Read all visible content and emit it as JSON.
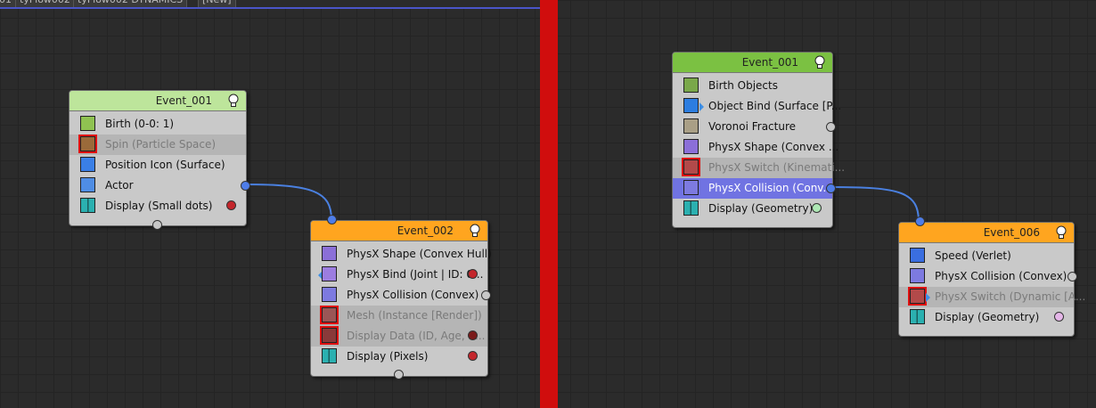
{
  "tabs": [
    "01",
    "tyFlow002",
    "tyFlow002 DYNAMICS",
    "[New]"
  ],
  "colors": {
    "header_green_light": "#bde59b",
    "header_green": "#7bc142",
    "header_orange": "#ffa51f",
    "wire": "#4a80e0",
    "port_blue": "#4e7de8",
    "port_gray": "#c8c8c8",
    "swatch_red": "#c4262c",
    "swatch_darkred": "#7a1a1a",
    "swatch_green": "#aee8b5",
    "swatch_pink": "#e5b6e8",
    "divider_red": "#d00d0d"
  },
  "nodes": [
    {
      "title": "Event_001",
      "operators": [
        {
          "label": "Birth (0-0: 1)",
          "icon": "birth-icon"
        },
        {
          "label": "Spin (Particle Space)",
          "icon": "spin-icon",
          "disabled": true
        },
        {
          "label": "Position Icon (Surface)",
          "icon": "position-icon"
        },
        {
          "label": "Actor",
          "icon": "actor-icon"
        },
        {
          "label": "Display (Small dots)",
          "icon": "display-icon"
        }
      ]
    },
    {
      "title": "Event_002",
      "operators": [
        {
          "label": "PhysX Shape (Convex Hull)",
          "icon": "physx-shape-icon"
        },
        {
          "label": "PhysX Bind (Joint | ID: 0...",
          "icon": "physx-bind-icon"
        },
        {
          "label": "PhysX Collision (Convex)",
          "icon": "physx-collision-icon"
        },
        {
          "label": "Mesh (Instance [Render])",
          "icon": "mesh-icon",
          "disabled": true
        },
        {
          "label": "Display Data (ID, Age, E...",
          "icon": "display-data-icon",
          "disabled": true
        },
        {
          "label": "Display (Pixels)",
          "icon": "display-icon"
        }
      ]
    },
    {
      "title": "Event_001",
      "operators": [
        {
          "label": "Birth Objects",
          "icon": "birth-objects-icon"
        },
        {
          "label": "Object Bind (Surface [P...",
          "icon": "object-bind-icon"
        },
        {
          "label": "Voronoi Fracture",
          "icon": "voronoi-icon"
        },
        {
          "label": "PhysX Shape (Convex ...",
          "icon": "physx-shape-icon"
        },
        {
          "label": "PhysX Switch (Kinemati...",
          "icon": "physx-switch-icon",
          "disabled": true
        },
        {
          "label": "PhysX Collision (Conv...",
          "icon": "physx-collision-icon",
          "selected": true
        },
        {
          "label": "Display (Geometry)",
          "icon": "display-icon"
        }
      ]
    },
    {
      "title": "Event_006",
      "operators": [
        {
          "label": "Speed (Verlet)",
          "icon": "speed-icon"
        },
        {
          "label": "PhysX Collision (Convex)",
          "icon": "physx-collision-icon"
        },
        {
          "label": "PhysX Switch (Dynamic [A...",
          "icon": "physx-switch-icon",
          "disabled": true
        },
        {
          "label": "Display (Geometry)",
          "icon": "display-icon"
        }
      ]
    }
  ]
}
